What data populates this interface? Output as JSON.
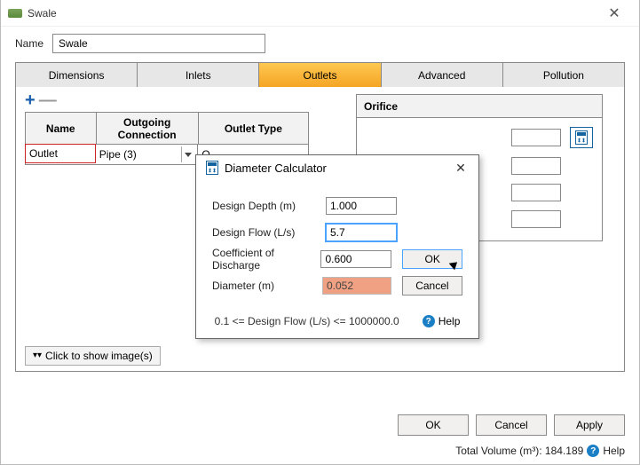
{
  "window": {
    "title": "Swale",
    "close": "✕"
  },
  "name": {
    "label": "Name",
    "value": "Swale"
  },
  "tabs": {
    "items": [
      "Dimensions",
      "Inlets",
      "Outlets",
      "Advanced",
      "Pollution"
    ],
    "active_index": 2
  },
  "outlets": {
    "headers": {
      "name": "Name",
      "connection": "Outgoing Connection",
      "type": "Outlet Type"
    },
    "rows": [
      {
        "name": "Outlet",
        "connection": "Pipe (3)",
        "type_prefix": "O"
      }
    ],
    "orifice_header": "Orifice"
  },
  "calculator": {
    "title": "Diameter Calculator",
    "close": "✕",
    "fields": {
      "depth": {
        "label": "Design Depth (m)",
        "value": "1.000"
      },
      "flow": {
        "label": "Design Flow (L/s)",
        "value": "5.7"
      },
      "cd": {
        "label": "Coefficient of Discharge",
        "value": "0.600"
      },
      "diameter": {
        "label": "Diameter (m)",
        "value": "0.052"
      }
    },
    "buttons": {
      "ok": "OK",
      "cancel": "Cancel"
    },
    "hint": "0.1 <= Design Flow (L/s) <= 1000000.0",
    "help": "Help"
  },
  "show_images_toggle": "Click to show image(s)",
  "footer": {
    "ok": "OK",
    "cancel": "Cancel",
    "apply": "Apply"
  },
  "status": {
    "volume_label": "Total Volume (m³): 184.189",
    "help": "Help"
  }
}
